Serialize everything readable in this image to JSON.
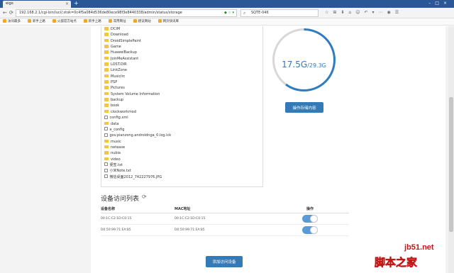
{
  "browser": {
    "tab_title": "eigo",
    "url": "192.168.2.1/cgi-bin/luci/;stok=0c4f5a084d536de80ece98f3e8440338/admin/status/storage",
    "search_value": "SQTE-046",
    "bookmarks": [
      "访问最多",
      "新手上路",
      "火狐官方站点",
      "新手上路",
      "常用网址",
      "建议网站",
      "网页快讯库"
    ]
  },
  "files": [
    {
      "name": "DCIM",
      "type": "folder"
    },
    {
      "name": "Download",
      "type": "folder"
    },
    {
      "name": "DroidSimplePaint",
      "type": "folder"
    },
    {
      "name": "Game",
      "type": "folder"
    },
    {
      "name": "HuaweiBackup",
      "type": "folder"
    },
    {
      "name": "JoinMeAssistant",
      "type": "folder"
    },
    {
      "name": "LOST.DIR",
      "type": "folder"
    },
    {
      "name": "LinkZone",
      "type": "folder"
    },
    {
      "name": "Musiclrc",
      "type": "folder"
    },
    {
      "name": "PSP",
      "type": "folder"
    },
    {
      "name": "Pictures",
      "type": "folder"
    },
    {
      "name": "System Volume Information",
      "type": "folder"
    },
    {
      "name": "backup",
      "type": "folder"
    },
    {
      "name": "book",
      "type": "folder"
    },
    {
      "name": "clockworkmod",
      "type": "folder"
    },
    {
      "name": "config.xml",
      "type": "file"
    },
    {
      "name": "data",
      "type": "folder"
    },
    {
      "name": "e_config",
      "type": "file"
    },
    {
      "name": "gov.pianzong.androidnga_0.log.lck",
      "type": "file"
    },
    {
      "name": "music",
      "type": "folder"
    },
    {
      "name": "netease",
      "type": "folder"
    },
    {
      "name": "nubia",
      "type": "folder"
    },
    {
      "name": "video",
      "type": "folder"
    },
    {
      "name": "便签.txt",
      "type": "file"
    },
    {
      "name": "小米Note.txt",
      "type": "file"
    },
    {
      "name": "微信桌面2012_742227976.JPG",
      "type": "file"
    }
  ],
  "storage": {
    "used": "17.5G",
    "total": "/29.3G",
    "used_fraction": 0.6,
    "ring_color": "#2f7dc1",
    "track_color": "#d8d8d8",
    "op_button": "操作存储内容"
  },
  "devices": {
    "title": "设备访问列表",
    "col_name": "设备名称",
    "col_mac": "MAC地址",
    "col_action": "操作",
    "rows": [
      {
        "name": "00:1C:C2:1D:C0:15",
        "mac": "00:1C:C2:1D:C0:15",
        "enabled": true
      },
      {
        "name": "D0:50:99:71:EA:85",
        "mac": "D0:50:99:71:EA:85",
        "enabled": true
      }
    ],
    "add_button": "添加访问设备"
  },
  "watermark": {
    "top": "jb51.net",
    "bottom": "脚本之家"
  }
}
